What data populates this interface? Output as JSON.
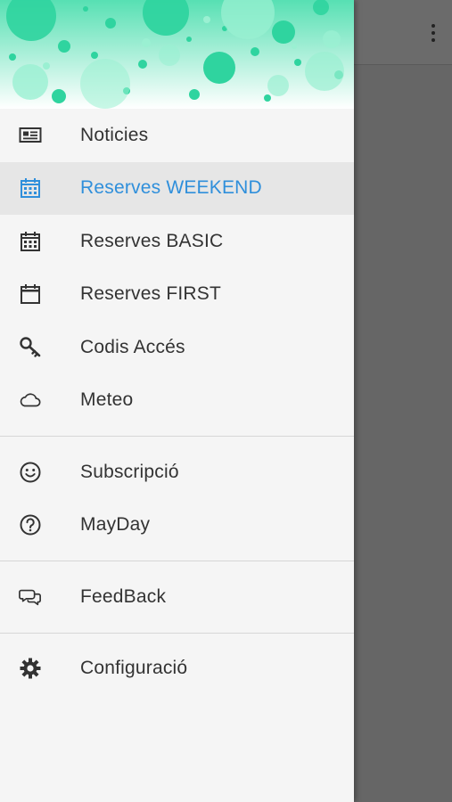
{
  "app": {
    "overflow_icon": "more-vert-icon"
  },
  "colors": {
    "accent": "#2f8fdb",
    "header_bg": "#ffffff",
    "bubble": "#37d6a6",
    "overlay": "#666666"
  },
  "menu": {
    "groups": [
      {
        "items": [
          {
            "label": "Noticies",
            "icon": "newspaper-icon",
            "active": false
          },
          {
            "label": "Reserves WEEKEND",
            "icon": "calendar-grid-icon",
            "active": true
          },
          {
            "label": "Reserves BASIC",
            "icon": "calendar-grid-icon",
            "active": false
          },
          {
            "label": "Reserves FIRST",
            "icon": "calendar-blank-icon",
            "active": false
          },
          {
            "label": "Codis Accés",
            "icon": "key-icon",
            "active": false
          },
          {
            "label": "Meteo",
            "icon": "cloud-icon",
            "active": false
          }
        ]
      },
      {
        "items": [
          {
            "label": "Subscripció",
            "icon": "smiley-icon",
            "active": false
          },
          {
            "label": "MayDay",
            "icon": "help-circle-icon",
            "active": false
          }
        ]
      },
      {
        "items": [
          {
            "label": "FeedBack",
            "icon": "chat-bubbles-icon",
            "active": false
          }
        ]
      },
      {
        "items": [
          {
            "label": "Configuració",
            "icon": "gear-icon",
            "active": false
          }
        ]
      }
    ]
  }
}
